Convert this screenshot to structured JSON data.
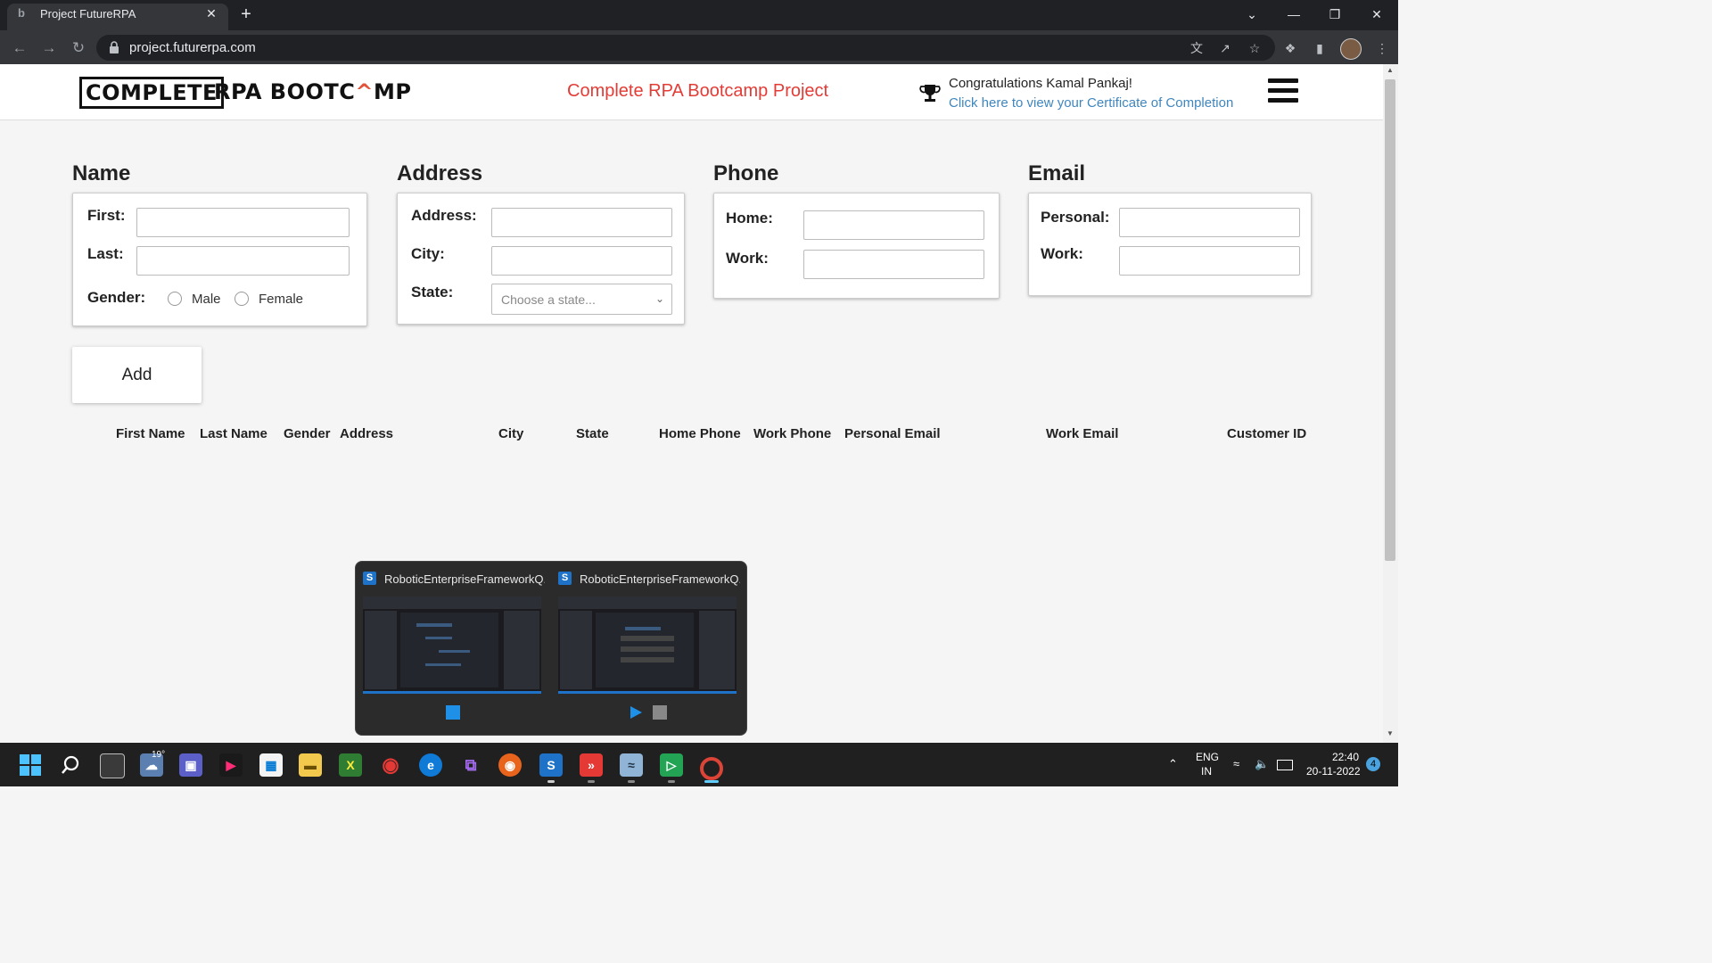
{
  "browser": {
    "tab_title": "Project FutureRPA",
    "tab_close": "✕",
    "new_tab": "+",
    "url": "project.futurerpa.com"
  },
  "site": {
    "logo_boxed": "COMPLETE",
    "logo_rest_1": "RPA BOOTC",
    "logo_rest_accent": "^",
    "logo_rest_2": "MP",
    "project_title": "Complete RPA Bootcamp Project",
    "congrats": "Congratulations Kamal Pankaj!",
    "cert_link": "Click here to view your Certificate of Completion"
  },
  "form": {
    "name": {
      "title": "Name",
      "first_label": "First:",
      "last_label": "Last:",
      "gender_label": "Gender:",
      "male": "Male",
      "female": "Female"
    },
    "address": {
      "title": "Address",
      "address_label": "Address:",
      "city_label": "City:",
      "state_label": "State:",
      "state_placeholder": "Choose a state..."
    },
    "phone": {
      "title": "Phone",
      "home_label": "Home:",
      "work_label": "Work:"
    },
    "email": {
      "title": "Email",
      "personal_label": "Personal:",
      "work_label": "Work:"
    },
    "add_button": "Add"
  },
  "table": {
    "columns": [
      "First Name",
      "Last Name",
      "Gender",
      "Address",
      "City",
      "State",
      "Home Phone",
      "Work Phone",
      "Personal Email",
      "Work Email",
      "Customer ID"
    ]
  },
  "preview": {
    "window1_title": "RoboticEnterpriseFrameworkQ...",
    "window2_title": "RoboticEnterpriseFrameworkQ..."
  },
  "taskbar": {
    "weather_temp": "19°",
    "lang_1": "ENG",
    "lang_2": "IN",
    "time": "22:40",
    "date": "20-11-2022",
    "notifications": "4"
  }
}
